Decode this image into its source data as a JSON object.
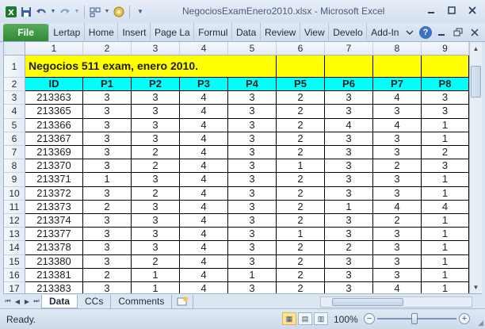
{
  "window": {
    "title": "NegociosExamEnero2010.xlsx - Microsoft Excel",
    "minimize_icon": "minimize-icon",
    "restore_icon": "restore-icon",
    "close_icon": "close-icon"
  },
  "qat": {
    "icons": [
      "excel-icon",
      "save-icon",
      "undo-icon",
      "redo-icon",
      "form-icon",
      "circle-icon",
      "customize-icon"
    ]
  },
  "ribbon": {
    "file": "File",
    "tabs": [
      "Lertap",
      "Home",
      "Insert",
      "Page La",
      "Formul",
      "Data",
      "Review",
      "View",
      "Develo",
      "Add-In"
    ]
  },
  "sheet": {
    "col_headers": [
      "1",
      "2",
      "3",
      "4",
      "5",
      "6",
      "7",
      "8",
      "9"
    ],
    "row_headers": [
      "1",
      "2",
      "3",
      "4",
      "5",
      "6",
      "7",
      "8",
      "9",
      "10",
      "11",
      "12",
      "13",
      "14",
      "15",
      "16",
      "17"
    ],
    "title_text": "Negocios 511 exam, enero 2010.",
    "header_row": [
      "ID",
      "P1",
      "P2",
      "P3",
      "P4",
      "P5",
      "P6",
      "P7",
      "P8"
    ],
    "rows": [
      [
        "213363",
        "3",
        "3",
        "4",
        "3",
        "2",
        "3",
        "4",
        "3"
      ],
      [
        "213365",
        "3",
        "3",
        "4",
        "3",
        "2",
        "3",
        "3",
        "3"
      ],
      [
        "213366",
        "3",
        "3",
        "4",
        "3",
        "2",
        "4",
        "4",
        "1"
      ],
      [
        "213367",
        "3",
        "3",
        "4",
        "3",
        "2",
        "3",
        "3",
        "1"
      ],
      [
        "213369",
        "3",
        "2",
        "4",
        "3",
        "2",
        "3",
        "3",
        "2"
      ],
      [
        "213370",
        "3",
        "2",
        "4",
        "3",
        "1",
        "3",
        "2",
        "3"
      ],
      [
        "213371",
        "1",
        "3",
        "4",
        "3",
        "2",
        "3",
        "3",
        "1"
      ],
      [
        "213372",
        "3",
        "2",
        "4",
        "3",
        "2",
        "3",
        "3",
        "1"
      ],
      [
        "213373",
        "2",
        "3",
        "4",
        "3",
        "2",
        "1",
        "4",
        "4"
      ],
      [
        "213374",
        "3",
        "3",
        "4",
        "3",
        "2",
        "3",
        "2",
        "1"
      ],
      [
        "213377",
        "3",
        "3",
        "4",
        "3",
        "1",
        "3",
        "3",
        "1"
      ],
      [
        "213378",
        "3",
        "3",
        "4",
        "3",
        "2",
        "2",
        "3",
        "1"
      ],
      [
        "213380",
        "3",
        "2",
        "4",
        "3",
        "2",
        "3",
        "3",
        "1"
      ],
      [
        "213381",
        "2",
        "1",
        "4",
        "1",
        "2",
        "3",
        "3",
        "1"
      ],
      [
        "213383",
        "3",
        "1",
        "4",
        "3",
        "2",
        "3",
        "4",
        "1"
      ]
    ]
  },
  "sheet_tabs": [
    "Data",
    "CCs",
    "Comments"
  ],
  "status": {
    "text": "Ready.",
    "zoom": "100%"
  },
  "colors": {
    "title_fill": "#ffff00",
    "header_fill": "#00ffff",
    "file_tab": "#2f8a34"
  }
}
